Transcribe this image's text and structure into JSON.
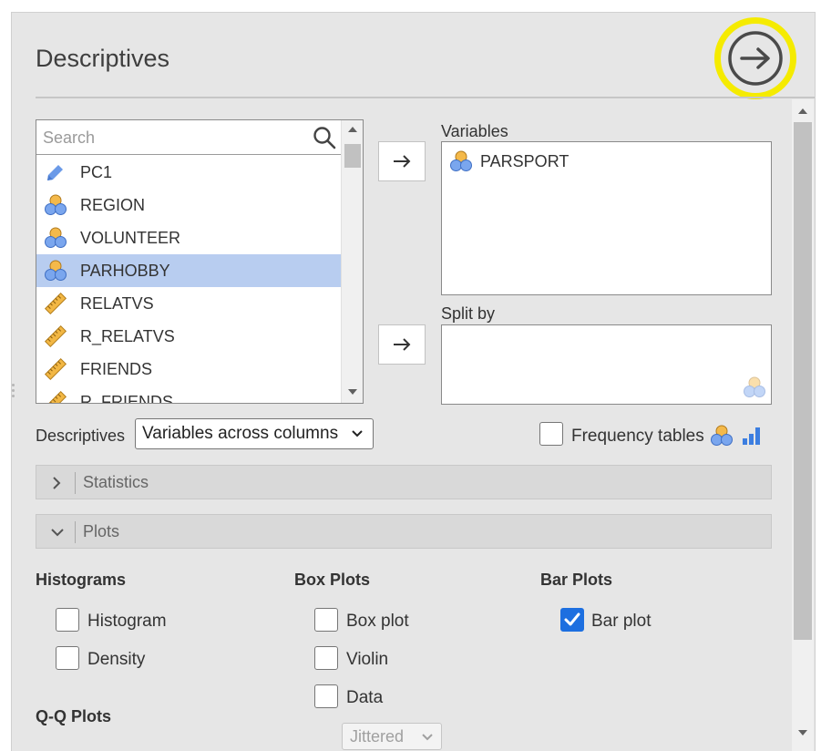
{
  "panel": {
    "title": "Descriptives",
    "run_icon": "arrow-right-circle-icon",
    "highlight_color": "#f5eb00"
  },
  "variable_list": {
    "search_placeholder": "Search",
    "items": [
      {
        "label": "PC1",
        "icon": "continuous-pencil-icon"
      },
      {
        "label": "REGION",
        "icon": "nominal-icon"
      },
      {
        "label": "VOLUNTEER",
        "icon": "nominal-icon"
      },
      {
        "label": "PARHOBBY",
        "icon": "nominal-icon",
        "selected": true
      },
      {
        "label": "RELATVS",
        "icon": "ordinal-ruler-icon"
      },
      {
        "label": "R_RELATVS",
        "icon": "ordinal-ruler-icon"
      },
      {
        "label": "FRIENDS",
        "icon": "ordinal-ruler-icon"
      },
      {
        "label": "R_FRIENDS",
        "icon": "ordinal-ruler-icon"
      }
    ]
  },
  "variables_box": {
    "label": "Variables",
    "items": [
      {
        "label": "PARSPORT",
        "icon": "nominal-icon"
      }
    ]
  },
  "split_by_box": {
    "label": "Split by"
  },
  "descriptives_option": {
    "label": "Descriptives",
    "selected": "Variables across columns"
  },
  "frequency_tables": {
    "label": "Frequency tables",
    "checked": false
  },
  "sections": {
    "statistics": "Statistics",
    "plots": "Plots"
  },
  "plots": {
    "histograms": {
      "heading": "Histograms",
      "options": [
        {
          "label": "Histogram",
          "checked": false
        },
        {
          "label": "Density",
          "checked": false
        }
      ]
    },
    "box_plots": {
      "heading": "Box Plots",
      "options": [
        {
          "label": "Box plot",
          "checked": false
        },
        {
          "label": "Violin",
          "checked": false
        },
        {
          "label": "Data",
          "checked": false
        }
      ],
      "data_style": "Jittered"
    },
    "bar_plots": {
      "heading": "Bar Plots",
      "options": [
        {
          "label": "Bar plot",
          "checked": true
        }
      ]
    },
    "qq_plots": {
      "heading": "Q-Q Plots"
    }
  },
  "colors": {
    "selected_row": "#b8cdf0",
    "checkbox_checked": "#1d6fe0",
    "panel_bg": "#e6e6e6"
  }
}
